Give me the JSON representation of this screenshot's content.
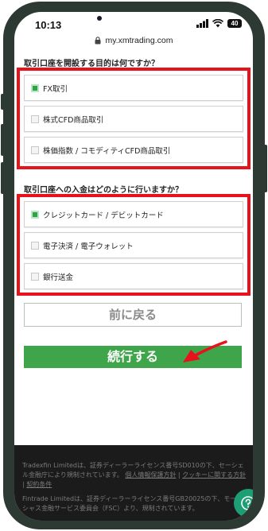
{
  "status_bar": {
    "time": "10:13",
    "battery": "40"
  },
  "browser": {
    "url": "my.xmtrading.com"
  },
  "form": {
    "question1": "取引口座を開設する目的は何ですか？",
    "purpose_options": [
      {
        "label": "FX取引",
        "checked": true
      },
      {
        "label": "株式CFD商品取引",
        "checked": false
      },
      {
        "label": "株価指数 / コモディティCFD商品取引",
        "checked": false
      }
    ],
    "question2": "取引口座への入金はどのように行いますか？",
    "deposit_options": [
      {
        "label": "クレジットカード / デビットカード",
        "checked": true
      },
      {
        "label": "電子決済 / 電子ウォレット",
        "checked": false
      },
      {
        "label": "銀行送金",
        "checked": false
      }
    ],
    "back_label": "前に戻る",
    "continue_label": "続行する"
  },
  "footer": {
    "line1": "Tradexfin Limitedは、証券ディーラーライセンス番号SD010の下、セーシェル金融庁により規制されています。",
    "privacy_link": "個人情報保護方針",
    "cookie_link": "クッキーに関する方針",
    "separator": "|",
    "terms_link": "契約条件",
    "line2": "Fintrade Limitedは、証券ディーラーライセンス番号GB20025の下、モーリシャス金融サービス委員会（FSC）より、規制されています。"
  },
  "colors": {
    "highlight": "#e8121c",
    "checked": "#28a745",
    "primary_button": "#3fa54a",
    "help_fab": "#1e9e74"
  },
  "icons": {
    "lock": "lock-icon",
    "help": "question-mark-icon",
    "annotation": "red-arrow"
  }
}
